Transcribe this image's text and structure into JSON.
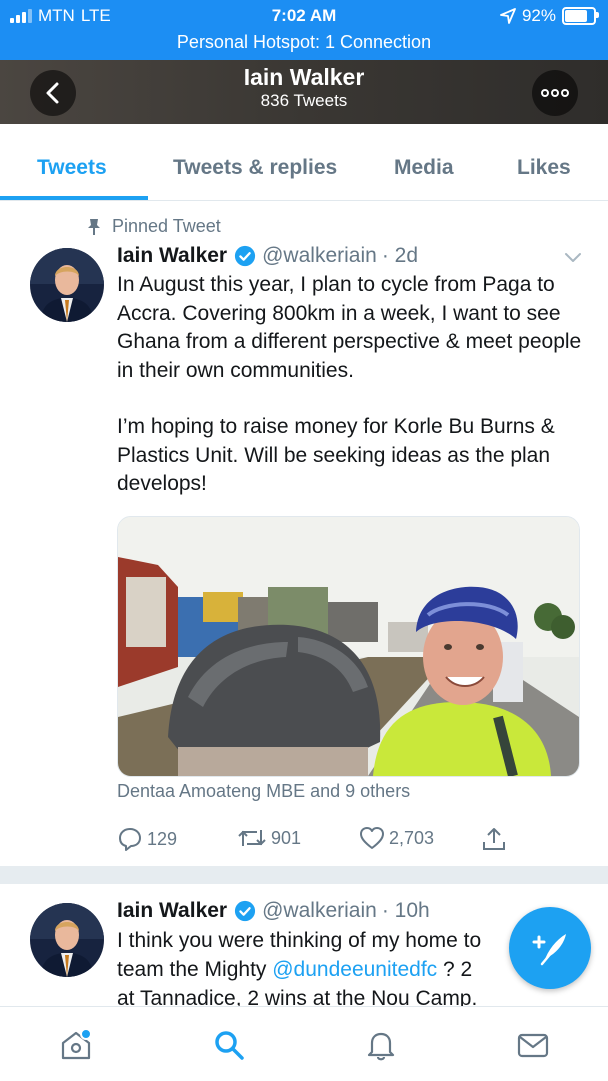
{
  "status_bar": {
    "carrier": "MTN",
    "network": "LTE",
    "time": "7:02 AM",
    "battery": "92%",
    "battery_level": 0.92,
    "hotspot": "Personal Hotspot: 1 Connection",
    "color": "#1c8ef3"
  },
  "header": {
    "name": "Iain Walker",
    "tweet_count": "836 Tweets",
    "back_icon": "chevron-left-icon",
    "more_icon": "ellipsis-icon"
  },
  "tabs": [
    {
      "label": "Tweets",
      "active": true
    },
    {
      "label": "Tweets & replies",
      "active": false
    },
    {
      "label": "Media",
      "active": false
    },
    {
      "label": "Likes",
      "active": false
    }
  ],
  "pinned_tweet": {
    "pinned_label": "Pinned Tweet",
    "name": "Iain Walker",
    "handle": "@walkeriain",
    "time": "· 2d",
    "text_p1": "In August this year, I plan to cycle from Paga to Accra. Covering 800km in a week, I want to see Ghana from a different perspective & meet people in their own communities.",
    "text_p2": "I’m hoping to raise money for Korle Bu Burns & Plastics Unit.  Will be seeking ideas as the plan develops!",
    "liked_by": "Dentaa Amoateng MBE and 9 others",
    "replies": "129",
    "retweets": "901",
    "likes": "2,703"
  },
  "second_tweet": {
    "name": "Iain Walker",
    "handle": "@walkeriain",
    "time": "· 10h",
    "line1": "I think you were thinking of my home to",
    "line2_pre": "team the Mighty ",
    "line2_mention": "@dundeeunitedfc",
    "line2_post": " ?  2 ",
    "line3": "at Tannadice, 2 wins at the Nou Camp."
  },
  "bottom_nav": [
    "home-icon",
    "search-icon",
    "notifications-icon",
    "messages-icon"
  ],
  "colors": {
    "accent": "#1da1f2",
    "secondary_text": "#657786",
    "divider": "#e6ecf0"
  }
}
